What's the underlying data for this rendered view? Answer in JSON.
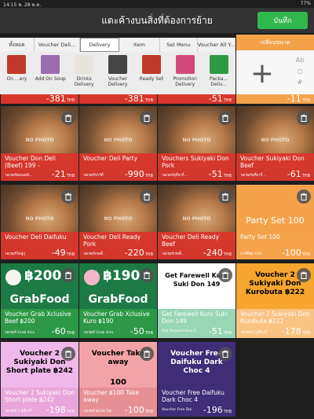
{
  "status": {
    "time": "14:15",
    "date": "พ. 28 พ.ค.",
    "battery": "77%"
  },
  "header": {
    "title": "แตะค้างบนสิ่งที่ต้องการย้าย",
    "save_label": "บันทึก"
  },
  "tabs": [
    "ทั้งหมด",
    "Voucher Deli...",
    "Delivery",
    "Item",
    "Set Menu",
    "Voucher All Y..."
  ],
  "active_tab": "Delivery",
  "categories": [
    {
      "label": "On ...ery",
      "color": "#c0392b"
    },
    {
      "label": "Add On Soup",
      "color": "#9b6bb0"
    },
    {
      "label": "Drinks Delivery",
      "color": "#e8e4dc"
    },
    {
      "label": "Voucher Delivery",
      "color": "#444444"
    },
    {
      "label": "Ready Set",
      "color": "#c0392b"
    },
    {
      "label": "Promotion Delivery",
      "color": "#d14a7b"
    },
    {
      "label": "Packa... Deliv...",
      "color": "#2e9a46"
    }
  ],
  "size_panel": {
    "header": "เปลี่ยนขนาด",
    "plus": "+",
    "labels": [
      "Ab",
      "◻",
      "#"
    ]
  },
  "partial_prices": [
    "-381",
    "-381",
    "-51",
    "-11"
  ],
  "currency": "THB",
  "no_photo": "NO PHOTO",
  "tiles": [
    {
      "name": "Voucher Don Deli (Beef) 199 -",
      "sub": "วอเชอร์ดอนเดลิ...",
      "price": "-21"
    },
    {
      "name": "Voucher Deli Party",
      "sub": "วอเชอร์ปาร์ตี้",
      "price": "-990"
    },
    {
      "name": "Vouchers Sukiyaki Don Pork",
      "sub": "วอเชอร์สุกี้ยากี้...",
      "price": "-51"
    },
    {
      "name": "Voucher Sukiyaki Don Beef",
      "sub": "วอเชอร์สุกี้ยากี้...",
      "price": "-61"
    },
    {
      "name": "Voucher Deli Daifuku",
      "sub": "วอเชอร์ไดฟูกุ",
      "price": "-49"
    },
    {
      "name": "Voucher Deli Ready Pork",
      "sub": "วอเชอร์เรดดี้...",
      "price": "-220"
    },
    {
      "name": "Voucher Deli Ready Beef",
      "sub": "วอเชอร์เรดดี้...",
      "price": "-240"
    },
    {
      "name": "Party Set 100",
      "sub": "ปาร์ตี้ชุด 100.-",
      "price": "-100",
      "big": "Party Set 100"
    },
    {
      "name": "Voucher Grab Xclusive Beef ฿200",
      "sub": "วอเชอร์ Grab Xclu",
      "price": "-60",
      "logo": "GrabFood",
      "amount": "฿200"
    },
    {
      "name": "Voucher Grab Xclusive Kuro ฿190",
      "sub": "วอเชอร์ Grab Xclu",
      "price": "-50",
      "logo": "GrabFood",
      "amount": "฿190"
    },
    {
      "name": "Get Farewell Kuro Suki Don 149",
      "sub": "Get Farewell Kuro S",
      "price": "-51",
      "poster": "Get Farewell Kuro Suki Don 149"
    },
    {
      "name": "Voucher 2 Sukiyaki Don Kurobuta ฿222",
      "sub": "วอเชอร์ 2 สุกี้ยากี้",
      "price": "-178",
      "poster": "Voucher 2 Sukiyaki Don Kurobuta ฿222"
    },
    {
      "name": "Voucher 2 Sukiyaki Don Short plate ฿242",
      "sub": "วอเชอร์ 2 สุกี้ยากี้",
      "price": "-198",
      "poster": "Voucher 2 Sukiyaki Don Short plate ฿242"
    },
    {
      "name": "Voucher ฿100 Take away",
      "sub": "วอเชอร์ ฿100 Tak",
      "price": "-100",
      "poster": "Voucher Take away",
      "poster2": "100"
    },
    {
      "name": "Voucher Free Daifuku Dark Choc 4",
      "sub": "Voucher Free Dai",
      "price": "-196",
      "poster": "Voucher Free Daifuku Dark Choc 4"
    }
  ],
  "colors": {
    "red_band": "#d9362b",
    "green_band": "#2e9a46",
    "orange": "#f4a24a",
    "mint": "#8fd3b0",
    "pink": "#e9a4d8",
    "rose": "#e58e95",
    "purple": "#3f2d78"
  }
}
